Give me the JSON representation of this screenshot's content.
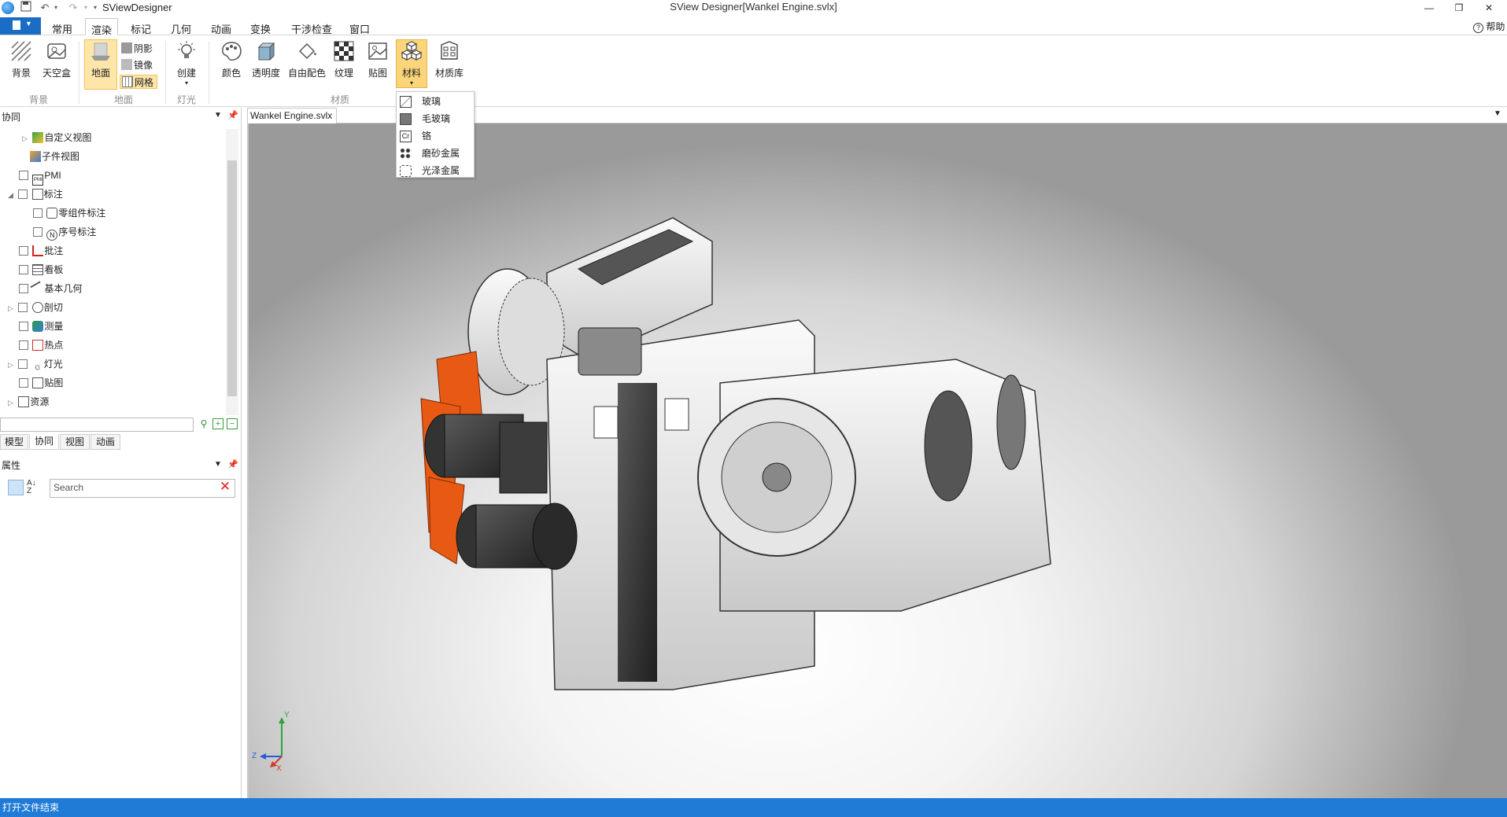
{
  "titlebar": {
    "app_name": "SViewDesigner",
    "window_title": "SView Designer[Wankel Engine.svlx]",
    "minimize": "—",
    "maximize": "❐",
    "close": "✕",
    "help": "帮助"
  },
  "ribbon": {
    "tabs": [
      "常用",
      "渲染",
      "标记",
      "几何",
      "动画",
      "变换",
      "干涉检查",
      "窗口"
    ],
    "active_tab": "渲染",
    "buttons": {
      "background": "背景",
      "skybox": "天空盒",
      "ground": "地面",
      "shadow": "阴影",
      "mirror": "镜像",
      "grid": "网格",
      "create": "创建",
      "color": "颜色",
      "transparency": "透明度",
      "free_color": "自由配色",
      "texture": "纹理",
      "decal": "贴图",
      "material": "材料",
      "material_library": "材质库"
    },
    "groups": {
      "background": "背景",
      "ground": "地面",
      "light": "灯光",
      "material": "材质"
    }
  },
  "material_menu": {
    "items": [
      "玻璃",
      "毛玻璃",
      "铬",
      "磨砂金属",
      "光泽金属"
    ],
    "chrome_icon_text": "Cr"
  },
  "left_panel": {
    "tree_header": "协同",
    "tree_items": [
      {
        "label": "自定义视图"
      },
      {
        "label": "子件视图"
      },
      {
        "label": "PMI",
        "icon_text": "PMI"
      },
      {
        "label": "标注"
      },
      {
        "label": "零组件标注"
      },
      {
        "label": "序号标注"
      },
      {
        "label": "批注"
      },
      {
        "label": "看板"
      },
      {
        "label": "基本几何"
      },
      {
        "label": "剖切"
      },
      {
        "label": "测量"
      },
      {
        "label": "热点"
      },
      {
        "label": "灯光"
      },
      {
        "label": "贴图"
      },
      {
        "label": "资源"
      }
    ],
    "bottom_tabs": [
      "模型",
      "协同",
      "视图",
      "动画"
    ],
    "active_bottom_tab": "协同",
    "props_header": "属性",
    "props_search_placeholder": "Search"
  },
  "document": {
    "tab_label": "Wankel Engine.svlx",
    "axis_labels": {
      "y": "Y",
      "z": "Z",
      "x": "X"
    }
  },
  "statusbar": {
    "text": "打开文件结束"
  },
  "colors": {
    "accent_blue": "#1b6cc4",
    "status_bar": "#1f7bd6",
    "pressed_highlight": "#fde6a8",
    "fan_orange": "#e85a14"
  }
}
